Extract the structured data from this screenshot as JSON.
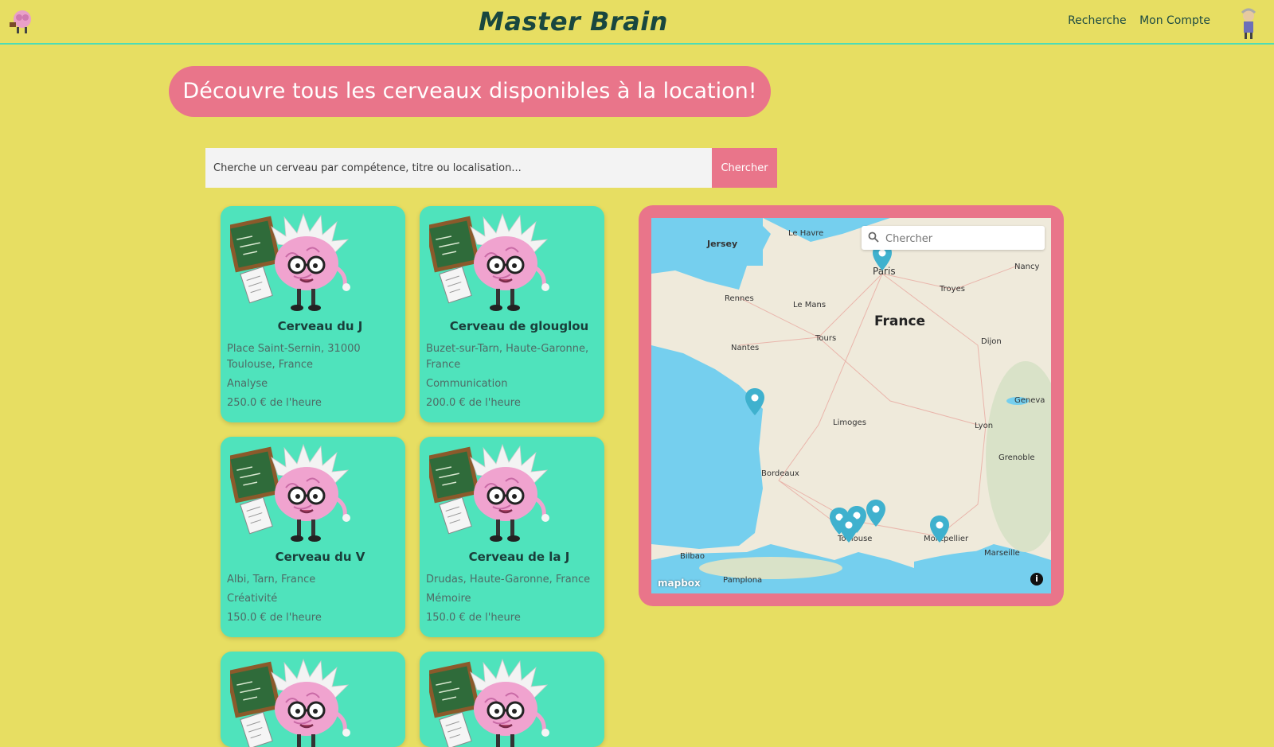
{
  "header": {
    "title": "Master Brain",
    "nav": [
      "Recherche",
      "Mon Compte"
    ],
    "colors": {
      "background": "#e7de62",
      "accent": "#e9758a",
      "card": "#4fe3bc",
      "title": "#19473f"
    }
  },
  "banner": {
    "text": "Découvre tous les cerveaux disponibles à la location!"
  },
  "search": {
    "placeholder": "Cherche un cerveau par compétence, titre ou localisation...",
    "button": "Chercher"
  },
  "cards": [
    {
      "title": "Cerveau du J",
      "address": "Place Saint-Sernin, 31000 Toulouse, France",
      "skill": "Analyse",
      "price": "250.0 € de l'heure"
    },
    {
      "title": "Cerveau de glouglou",
      "address": "Buzet-sur-Tarn, Haute-Garonne, France",
      "skill": "Communication",
      "price": "200.0 € de l'heure"
    },
    {
      "title": "Cerveau du V",
      "address": "Albi, Tarn, France",
      "skill": "Créativité",
      "price": "150.0 € de l'heure"
    },
    {
      "title": "Cerveau de la J",
      "address": "Drudas, Haute-Garonne, France",
      "skill": "Mémoire",
      "price": "150.0 € de l'heure"
    }
  ],
  "map": {
    "search_placeholder": "Chercher",
    "attribution": "mapbox",
    "info": "i",
    "labels": {
      "country": "France",
      "cities": [
        "Jersey",
        "Le Havre",
        "Paris",
        "Nancy",
        "Troyes",
        "Rennes",
        "Le Mans",
        "Tours",
        "Nantes",
        "Dijon",
        "Geneva",
        "Limoges",
        "Lyon",
        "Grenoble",
        "Bordeaux",
        "Toulouse",
        "Montpellier",
        "Marseille",
        "Bilbao",
        "Pamplona"
      ]
    }
  }
}
